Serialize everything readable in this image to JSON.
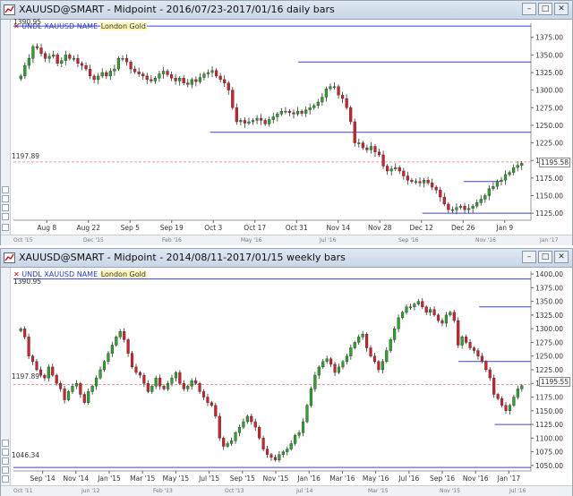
{
  "colors": {
    "up": "#2aa52a",
    "down": "#d4202b",
    "hline": "#3a45d6",
    "ref": "#ef9aa0",
    "axis": "#333333"
  },
  "top": {
    "title": "XAUUSD@SMART - Midpoint - 2016/07/23-2017/01/16 daily bars",
    "legend": {
      "symbol": "UNDL",
      "ticker": "XAUUSD",
      "name_label": "NAME",
      "name": "London Gold"
    },
    "price_tag": "1195.58",
    "ref_label": "1197.89",
    "top_label": "1390.95",
    "y_ticks": [
      "1375.00",
      "1350.00",
      "1325.00",
      "1300.00",
      "1275.00",
      "1250.00",
      "1225.00",
      "1200.00",
      "1175.00",
      "1150.00",
      "1125.00"
    ],
    "x_ticks": [
      "Aug 8",
      "Aug 22",
      "Sep 5",
      "Sep 19",
      "Oct 3",
      "Oct 17",
      "Oct 31",
      "Nov 14",
      "Nov 28",
      "Dec 12",
      "Dec 26",
      "Jan 9"
    ],
    "nav_ticks": [
      "Oct '15",
      "Dec '15",
      "Feb '16",
      "May '16",
      "Jul '16",
      "Sep '16",
      "Nov '16",
      "Jan '17"
    ],
    "icons": [
      "chart-settings-icon",
      "crosshair-icon",
      "zoom-icon",
      "draw-icon",
      "expand-icon"
    ]
  },
  "bottom": {
    "title": "XAUUSD@SMART - Midpoint - 2014/08/11-2017/01/15 weekly bars",
    "legend": {
      "symbol": "UNDL",
      "ticker": "XAUUSD",
      "name_label": "NAME",
      "name": "London Gold"
    },
    "price_tag": "1195.55",
    "ref_label": "1197.89",
    "top_label": "1390.95",
    "low_label": "1046.34",
    "y_ticks": [
      "1400.00",
      "1375.00",
      "1350.00",
      "1325.00",
      "1300.00",
      "1275.00",
      "1250.00",
      "1225.00",
      "1200.00",
      "1175.00",
      "1150.00",
      "1125.00",
      "1100.00",
      "1075.00",
      "1050.00"
    ],
    "x_ticks": [
      "Sep '14",
      "Nov '14",
      "Jan '15",
      "Mar '15",
      "May '15",
      "Jul '15",
      "Sep '15",
      "Nov '15",
      "Jan '16",
      "Mar '16",
      "May '16",
      "Jul '16",
      "Sep '16",
      "Nov '16",
      "Jan '17"
    ],
    "nav_ticks": [
      "Oct '11",
      "Jun '12",
      "Feb '13",
      "Oct '13",
      "Jul '14",
      "Mar '15",
      "Nov '15",
      "Jul '16"
    ],
    "icons": [
      "chart-settings-icon",
      "crosshair-icon",
      "zoom-icon",
      "draw-icon",
      "expand-icon"
    ]
  },
  "chart_data": [
    {
      "type": "candlestick",
      "title": "XAUUSD@SMART - Midpoint - 2016/07/23-2017/01/16 daily bars",
      "ylim": [
        1115,
        1395
      ],
      "x_labels": [
        "Aug 8",
        "Aug 22",
        "Sep 5",
        "Sep 19",
        "Oct 3",
        "Oct 17",
        "Oct 31",
        "Nov 14",
        "Nov 28",
        "Dec 12",
        "Dec 26",
        "Jan 9"
      ],
      "hlines": [
        1390.95,
        1340,
        1240,
        1197.89,
        1170,
        1125
      ],
      "close": [
        1320,
        1335,
        1345,
        1362,
        1360,
        1352,
        1345,
        1348,
        1350,
        1338,
        1342,
        1350,
        1345,
        1345,
        1338,
        1335,
        1330,
        1320,
        1315,
        1320,
        1325,
        1320,
        1327,
        1330,
        1345,
        1345,
        1340,
        1330,
        1326,
        1323,
        1320,
        1315,
        1313,
        1317,
        1323,
        1327,
        1322,
        1317,
        1313,
        1317,
        1310,
        1308,
        1315,
        1312,
        1318,
        1323,
        1325,
        1328,
        1320,
        1315,
        1310,
        1300,
        1275,
        1255,
        1257,
        1253,
        1255,
        1257,
        1260,
        1257,
        1252,
        1258,
        1262,
        1266,
        1270,
        1270,
        1268,
        1266,
        1270,
        1267,
        1272,
        1275,
        1278,
        1283,
        1290,
        1302,
        1305,
        1305,
        1293,
        1288,
        1275,
        1255,
        1225,
        1225,
        1218,
        1215,
        1220,
        1212,
        1208,
        1192,
        1185,
        1188,
        1190,
        1185,
        1178,
        1172,
        1170,
        1170,
        1168,
        1172,
        1168,
        1162,
        1158,
        1148,
        1138,
        1130,
        1130,
        1133,
        1135,
        1130,
        1132,
        1135,
        1140,
        1145,
        1150,
        1160,
        1163,
        1170,
        1172,
        1180,
        1183,
        1190,
        1193,
        1196
      ]
    },
    {
      "type": "candlestick",
      "title": "XAUUSD@SMART - Midpoint - 2014/08/11-2017/01/15 weekly bars",
      "ylim": [
        1040,
        1405
      ],
      "x_labels": [
        "Sep '14",
        "Nov '14",
        "Jan '15",
        "Mar '15",
        "May '15",
        "Jul '15",
        "Sep '15",
        "Nov '15",
        "Jan '16",
        "Mar '16",
        "May '16",
        "Jul '16",
        "Sep '16",
        "Nov '16",
        "Jan '17"
      ],
      "hlines": [
        1390.95,
        1340,
        1240,
        1197.89,
        1125,
        1046.34
      ],
      "close": [
        1300,
        1285,
        1250,
        1240,
        1225,
        1215,
        1210,
        1230,
        1215,
        1200,
        1190,
        1170,
        1185,
        1195,
        1200,
        1180,
        1165,
        1185,
        1195,
        1210,
        1225,
        1240,
        1255,
        1270,
        1285,
        1295,
        1280,
        1255,
        1230,
        1220,
        1215,
        1200,
        1185,
        1195,
        1210,
        1195,
        1190,
        1200,
        1210,
        1220,
        1200,
        1190,
        1195,
        1205,
        1200,
        1185,
        1175,
        1165,
        1160,
        1140,
        1100,
        1085,
        1090,
        1095,
        1110,
        1120,
        1130,
        1140,
        1130,
        1120,
        1100,
        1080,
        1070,
        1065,
        1060,
        1070,
        1075,
        1080,
        1090,
        1105,
        1110,
        1130,
        1160,
        1190,
        1215,
        1230,
        1240,
        1245,
        1235,
        1220,
        1230,
        1240,
        1250,
        1265,
        1275,
        1285,
        1290,
        1265,
        1250,
        1240,
        1225,
        1240,
        1260,
        1280,
        1300,
        1320,
        1330,
        1340,
        1340,
        1345,
        1350,
        1340,
        1330,
        1335,
        1325,
        1315,
        1310,
        1325,
        1330,
        1315,
        1270,
        1285,
        1275,
        1265,
        1260,
        1250,
        1240,
        1225,
        1210,
        1180,
        1172,
        1160,
        1150,
        1160,
        1175,
        1190,
        1196
      ]
    }
  ]
}
